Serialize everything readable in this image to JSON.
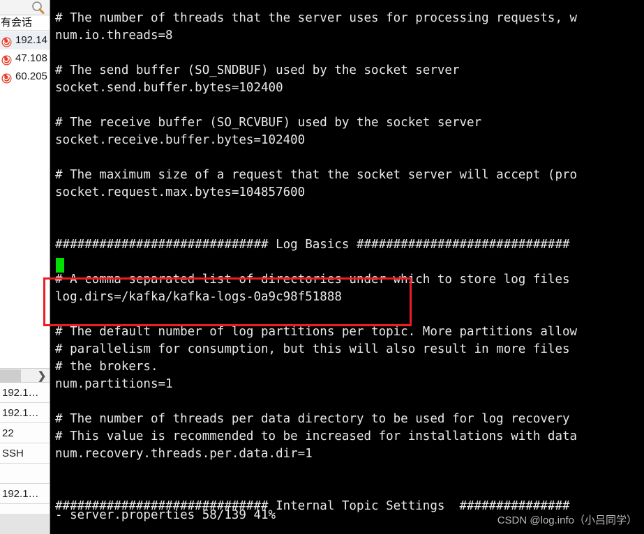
{
  "sidebar": {
    "header": "有会话",
    "search_icon": "search-icon",
    "sessions": [
      {
        "label": "192.14",
        "icon": "session-icon",
        "selected": true
      },
      {
        "label": "47.108",
        "icon": "session-icon",
        "selected": false
      },
      {
        "label": "60.205",
        "icon": "session-icon",
        "selected": false
      }
    ],
    "scroll_arrow": "❯",
    "properties": [
      "192.1…",
      "192.1…",
      "22",
      "SSH",
      "",
      "192.1…",
      ""
    ]
  },
  "terminal": {
    "lines": [
      "# The number of threads that the server uses for processing requests, w",
      "num.io.threads=8",
      "",
      "# The send buffer (SO_SNDBUF) used by the socket server",
      "socket.send.buffer.bytes=102400",
      "",
      "# The receive buffer (SO_RCVBUF) used by the socket server",
      "socket.receive.buffer.bytes=102400",
      "",
      "# The maximum size of a request that the socket server will accept (pro",
      "socket.request.max.bytes=104857600",
      "",
      "",
      "############################# Log Basics #############################",
      "",
      "# A comma separated list of directories under which to store log files",
      "log.dirs=/kafka/kafka-logs-0a9c98f51888",
      "",
      "# The default number of log partitions per topic. More partitions allow",
      "# parallelism for consumption, but this will also result in more files ",
      "# the brokers.",
      "num.partitions=1",
      "",
      "# The number of threads per data directory to be used for log recovery ",
      "# This value is recommended to be increased for installations with data",
      "num.recovery.threads.per.data.dir=1",
      "",
      "",
      "############################# Internal Topic Settings  ###############"
    ],
    "status": "- server.properties 58/139 41%",
    "cursor": "block-cursor"
  },
  "annotation": {
    "color": "#ee1c24",
    "name": "log-dirs-highlight"
  },
  "watermark": "CSDN @log.info（小吕同学）"
}
